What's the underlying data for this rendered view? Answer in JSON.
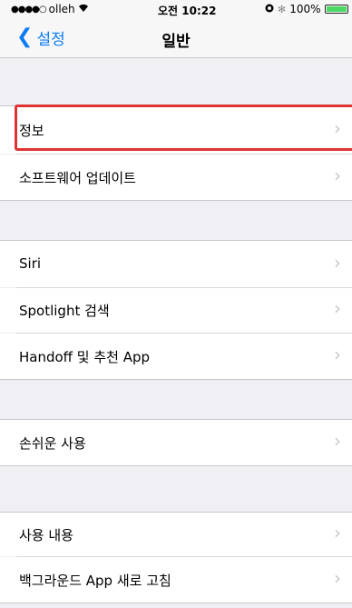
{
  "status_bar": {
    "carrier": "olleh",
    "time": "오전 10:22",
    "battery": "100%"
  },
  "nav": {
    "back_label": "설정",
    "title": "일반"
  },
  "groups": [
    {
      "items": [
        {
          "label": "정보"
        },
        {
          "label": "소프트웨어 업데이트"
        }
      ]
    },
    {
      "items": [
        {
          "label": "Siri"
        },
        {
          "label": "Spotlight 검색"
        },
        {
          "label": "Handoff 및 추천 App"
        }
      ]
    },
    {
      "items": [
        {
          "label": "손쉬운 사용"
        }
      ]
    },
    {
      "items": [
        {
          "label": "사용 내용"
        },
        {
          "label": "백그라운드 App 새로 고침"
        }
      ]
    }
  ],
  "highlight": {
    "target": "정보",
    "color": "#e03434"
  },
  "colors": {
    "accent": "#0a7bf5",
    "background": "#efeff4"
  }
}
